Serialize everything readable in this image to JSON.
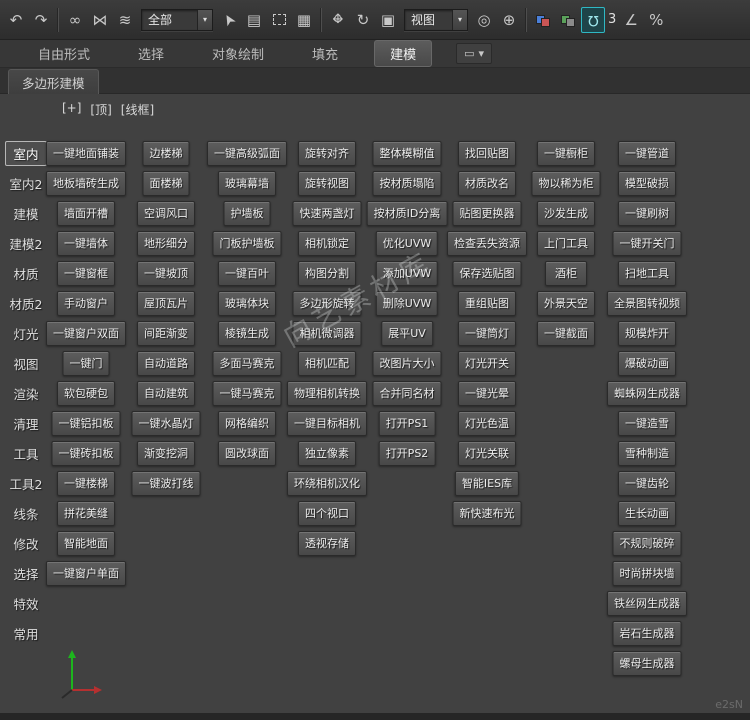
{
  "toolbar": {
    "selection_filter": "全部",
    "coord_system": "视图",
    "snap_value": "3",
    "icons": [
      {
        "name": "undo-icon",
        "glyph": "↶"
      },
      {
        "name": "redo-icon",
        "glyph": "↷"
      },
      {
        "name": "toolbar-separator",
        "type": "sep"
      },
      {
        "name": "select-link-icon",
        "glyph": "∞"
      },
      {
        "name": "unlink-icon",
        "glyph": "⋈"
      },
      {
        "name": "bind-spacewarp-icon",
        "glyph": "≋"
      },
      {
        "name": "selection-filter-dropdown",
        "type": "combo",
        "bind": "selection_filter"
      },
      {
        "name": "select-object-icon",
        "glyph": "➤",
        "rot": -120
      },
      {
        "name": "select-by-name-icon",
        "glyph": "▤"
      },
      {
        "name": "rect-select-icon",
        "type": "dashed"
      },
      {
        "name": "window-crossing-icon",
        "glyph": "▦"
      },
      {
        "name": "toolbar-separator",
        "type": "sep"
      },
      {
        "name": "move-icon",
        "type": "move"
      },
      {
        "name": "rotate-icon",
        "glyph": "↻"
      },
      {
        "name": "scale-icon",
        "glyph": "▣"
      },
      {
        "name": "coord-system-dropdown",
        "type": "combo",
        "bind": "coord_system"
      },
      {
        "name": "pivot-center-icon",
        "glyph": "◎"
      },
      {
        "name": "select-manipulate-icon",
        "glyph": "⊕"
      },
      {
        "name": "toolbar-separator",
        "type": "sep"
      },
      {
        "name": "layer-explorer-icon",
        "type": "colorpair",
        "colors": [
          "#4a7fd9",
          "#c95555"
        ]
      },
      {
        "name": "mirror-icon",
        "type": "colorpair",
        "colors": [
          "#5aa05a",
          "#8a8a8a"
        ]
      },
      {
        "name": "snap-toggle-icon",
        "type": "magnet",
        "active": true
      },
      {
        "name": "snap-count-label",
        "type": "label",
        "bind": "snap_value"
      },
      {
        "name": "angle-snap-icon",
        "glyph": "∠"
      },
      {
        "name": "percent-snap-icon",
        "glyph": "%"
      }
    ]
  },
  "ribbon": {
    "tabs": [
      {
        "label": "自由形式",
        "active": false
      },
      {
        "label": "选择",
        "active": false
      },
      {
        "label": "对象绘制",
        "active": false
      },
      {
        "label": "填充",
        "active": false
      },
      {
        "label": "建模",
        "active": true
      }
    ],
    "collapse_icon": "▭",
    "collapse_glyph": "▾",
    "panel_tab": "多边形建模"
  },
  "viewport": {
    "menu": "[+]",
    "view": "[顶]",
    "shading": "[线框]"
  },
  "sidebar": {
    "items": [
      {
        "label": "室内",
        "active": true
      },
      {
        "label": "室内2"
      },
      {
        "label": "建模"
      },
      {
        "label": "建模2"
      },
      {
        "label": "材质"
      },
      {
        "label": "材质2"
      },
      {
        "label": "灯光"
      },
      {
        "label": "视图"
      },
      {
        "label": "渲染"
      },
      {
        "label": "清理"
      },
      {
        "label": "工具"
      },
      {
        "label": "工具2"
      },
      {
        "label": "线条"
      },
      {
        "label": "修改"
      },
      {
        "label": "选择"
      },
      {
        "label": "特效"
      },
      {
        "label": "常用"
      }
    ]
  },
  "watermark": {
    "center": "向艺素材库",
    "corner": "e2sN"
  },
  "grid": {
    "buttons": [
      {
        "c": 0,
        "r": 0,
        "t": "一键地面铺装"
      },
      {
        "c": 0,
        "r": 1,
        "t": "地板墙砖生成"
      },
      {
        "c": 0,
        "r": 2,
        "t": "墙面开槽"
      },
      {
        "c": 0,
        "r": 3,
        "t": "一键墙体"
      },
      {
        "c": 0,
        "r": 4,
        "t": "一键窗框"
      },
      {
        "c": 0,
        "r": 5,
        "t": "手动窗户"
      },
      {
        "c": 0,
        "r": 6,
        "t": "一键窗户双面"
      },
      {
        "c": 0,
        "r": 7,
        "t": "一键门"
      },
      {
        "c": 0,
        "r": 8,
        "t": "软包硬包"
      },
      {
        "c": 0,
        "r": 9,
        "t": "一键铝扣板"
      },
      {
        "c": 0,
        "r": 10,
        "t": "一键砖扣板"
      },
      {
        "c": 0,
        "r": 11,
        "t": "一键楼梯"
      },
      {
        "c": 0,
        "r": 12,
        "t": "拼花美缝"
      },
      {
        "c": 0,
        "r": 13,
        "t": "智能地面"
      },
      {
        "c": 0,
        "r": 14,
        "t": "一键窗户单面"
      },
      {
        "c": 1,
        "r": 0,
        "t": "边楼梯"
      },
      {
        "c": 1,
        "r": 1,
        "t": "面楼梯"
      },
      {
        "c": 1,
        "r": 2,
        "t": "空调风口"
      },
      {
        "c": 1,
        "r": 3,
        "t": "地形细分"
      },
      {
        "c": 1,
        "r": 4,
        "t": "一键坡顶"
      },
      {
        "c": 1,
        "r": 5,
        "t": "屋顶瓦片"
      },
      {
        "c": 1,
        "r": 6,
        "t": "间距渐变"
      },
      {
        "c": 1,
        "r": 7,
        "t": "自动道路"
      },
      {
        "c": 1,
        "r": 8,
        "t": "自动建筑"
      },
      {
        "c": 1,
        "r": 9,
        "t": "一键水晶灯"
      },
      {
        "c": 1,
        "r": 10,
        "t": "渐变挖洞"
      },
      {
        "c": 1,
        "r": 11,
        "t": "一键波打线"
      },
      {
        "c": 2,
        "r": 0,
        "t": "一键高级弧面"
      },
      {
        "c": 2,
        "r": 1,
        "t": "玻璃幕墙"
      },
      {
        "c": 2,
        "r": 2,
        "t": "护墙板"
      },
      {
        "c": 2,
        "r": 3,
        "t": "门板护墙板"
      },
      {
        "c": 2,
        "r": 4,
        "t": "一键百叶"
      },
      {
        "c": 2,
        "r": 5,
        "t": "玻璃体块"
      },
      {
        "c": 2,
        "r": 6,
        "t": "棱镜生成"
      },
      {
        "c": 2,
        "r": 7,
        "t": "多面马赛克"
      },
      {
        "c": 2,
        "r": 8,
        "t": "一键马赛克"
      },
      {
        "c": 2,
        "r": 9,
        "t": "网格编织"
      },
      {
        "c": 2,
        "r": 10,
        "t": "圆改球面"
      },
      {
        "c": 3,
        "r": 0,
        "t": "旋转对齐"
      },
      {
        "c": 3,
        "r": 1,
        "t": "旋转视图"
      },
      {
        "c": 3,
        "r": 2,
        "t": "快速两盏灯"
      },
      {
        "c": 3,
        "r": 3,
        "t": "相机锁定"
      },
      {
        "c": 3,
        "r": 4,
        "t": "构图分割"
      },
      {
        "c": 3,
        "r": 5,
        "t": "多边形旋转"
      },
      {
        "c": 3,
        "r": 6,
        "t": "相机微调器"
      },
      {
        "c": 3,
        "r": 7,
        "t": "相机匹配"
      },
      {
        "c": 3,
        "r": 8,
        "t": "物理相机转换"
      },
      {
        "c": 3,
        "r": 9,
        "t": "一键目标相机"
      },
      {
        "c": 3,
        "r": 10,
        "t": "独立像素"
      },
      {
        "c": 3,
        "r": 11,
        "t": "环绕相机汉化"
      },
      {
        "c": 3,
        "r": 12,
        "t": "四个视口"
      },
      {
        "c": 3,
        "r": 13,
        "t": "透视存储"
      },
      {
        "c": 4,
        "r": 0,
        "t": "整体模糊值"
      },
      {
        "c": 4,
        "r": 1,
        "t": "按材质塌陷"
      },
      {
        "c": 4,
        "r": 2,
        "t": "按材质ID分离"
      },
      {
        "c": 4,
        "r": 3,
        "t": "优化UVW"
      },
      {
        "c": 4,
        "r": 4,
        "t": "添加UVW"
      },
      {
        "c": 4,
        "r": 5,
        "t": "删除UVW"
      },
      {
        "c": 4,
        "r": 6,
        "t": "展平UV"
      },
      {
        "c": 4,
        "r": 7,
        "t": "改图片大小"
      },
      {
        "c": 4,
        "r": 8,
        "t": "合并同名材"
      },
      {
        "c": 4,
        "r": 9,
        "t": "打开PS1"
      },
      {
        "c": 4,
        "r": 10,
        "t": "打开PS2"
      },
      {
        "c": 5,
        "r": 0,
        "t": "找回贴图"
      },
      {
        "c": 5,
        "r": 1,
        "t": "材质改名"
      },
      {
        "c": 5,
        "r": 2,
        "t": "贴图更换器"
      },
      {
        "c": 5,
        "r": 3,
        "t": "检查丢失资源"
      },
      {
        "c": 5,
        "r": 4,
        "t": "保存选贴图"
      },
      {
        "c": 5,
        "r": 5,
        "t": "重组贴图"
      },
      {
        "c": 5,
        "r": 6,
        "t": "一键筒灯"
      },
      {
        "c": 5,
        "r": 7,
        "t": "灯光开关"
      },
      {
        "c": 5,
        "r": 8,
        "t": "一键光晕"
      },
      {
        "c": 5,
        "r": 9,
        "t": "灯光色温"
      },
      {
        "c": 5,
        "r": 10,
        "t": "灯光关联"
      },
      {
        "c": 5,
        "r": 11,
        "t": "智能IES库"
      },
      {
        "c": 5,
        "r": 12,
        "t": "新快速布光"
      },
      {
        "c": 6,
        "r": 0,
        "t": "一键橱柜"
      },
      {
        "c": 6,
        "r": 1,
        "t": "物以稀为柜"
      },
      {
        "c": 6,
        "r": 2,
        "t": "沙发生成"
      },
      {
        "c": 6,
        "r": 3,
        "t": "上门工具"
      },
      {
        "c": 6,
        "r": 4,
        "t": "酒柜"
      },
      {
        "c": 6,
        "r": 5,
        "t": "外景天空"
      },
      {
        "c": 6,
        "r": 6,
        "t": "一键截面"
      },
      {
        "c": 7,
        "r": 0,
        "t": "一键管道"
      },
      {
        "c": 7,
        "r": 1,
        "t": "模型破损"
      },
      {
        "c": 7,
        "r": 2,
        "t": "一键刷树"
      },
      {
        "c": 7,
        "r": 3,
        "t": "一键开关门"
      },
      {
        "c": 7,
        "r": 4,
        "t": "扫地工具"
      },
      {
        "c": 7,
        "r": 5,
        "t": "全景图转视频"
      },
      {
        "c": 7,
        "r": 6,
        "t": "规模炸开"
      },
      {
        "c": 7,
        "r": 7,
        "t": "爆破动画"
      },
      {
        "c": 7,
        "r": 8,
        "t": "蜘蛛网生成器"
      },
      {
        "c": 7,
        "r": 9,
        "t": "一键造雪"
      },
      {
        "c": 7,
        "r": 10,
        "t": "雪种制造"
      },
      {
        "c": 7,
        "r": 11,
        "t": "一键齿轮"
      },
      {
        "c": 7,
        "r": 12,
        "t": "生长动画"
      },
      {
        "c": 7,
        "r": 13,
        "t": "不规则破碎"
      },
      {
        "c": 7,
        "r": 14,
        "t": "时尚拼块墙"
      },
      {
        "c": 7,
        "r": 15,
        "t": "铁丝网生成器"
      },
      {
        "c": 7,
        "r": 16,
        "t": "岩石生成器"
      },
      {
        "c": 7,
        "r": 17,
        "t": "螺母生成器"
      }
    ]
  }
}
